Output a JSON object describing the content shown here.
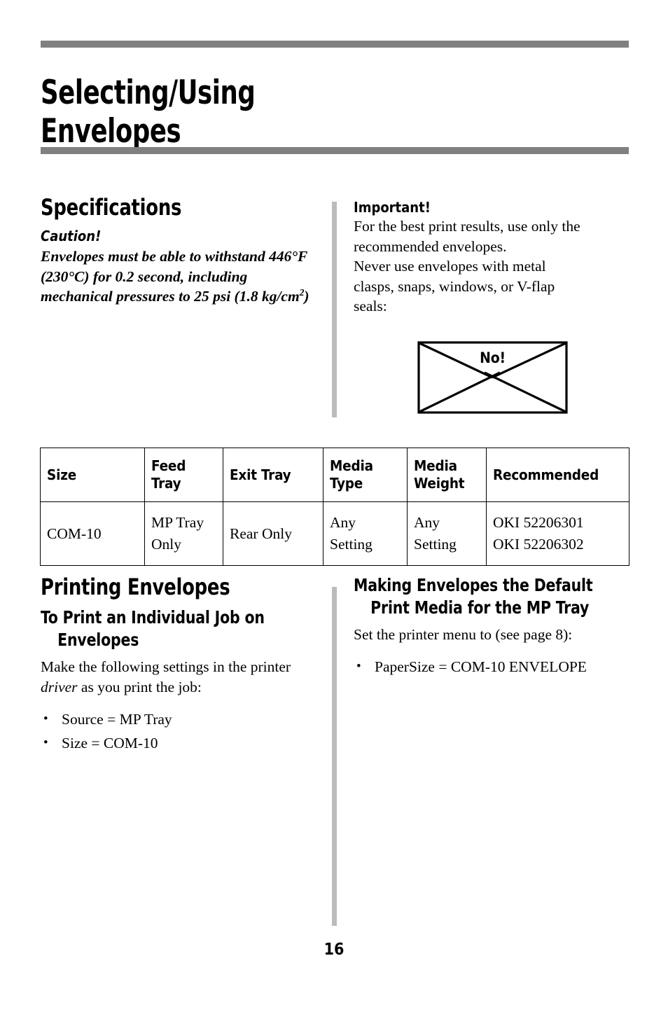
{
  "page": {
    "title": "Selecting/Using\nEnvelopes",
    "number": "16",
    "rule_color": "#808080",
    "divider_color": "#bcbcbc"
  },
  "specifications": {
    "heading": "Specifications",
    "caution_label": "Caution!",
    "caution_body_line1": "Envelopes must be able to withstand",
    "caution_body_line2": "446°F (230°C) for 0.2 second,",
    "caution_body_line3": "including mechanical pressures to 25",
    "caution_body_line4_pre": "psi (1.8 kg/cm",
    "caution_body_line4_sup": "2",
    "caution_body_line4_post": ")"
  },
  "important": {
    "label": "Important!",
    "line1": "For the best print results, use only the",
    "line2": "recommended envelopes.",
    "line3": "Never use envelopes with metal",
    "line4": "clasps, snaps, windows, or V-flap",
    "line5": "seals:"
  },
  "envelope_figure": {
    "label": "No!",
    "alt": "envelope-with-v-flap-not-allowed"
  },
  "table": {
    "headers": [
      "Size",
      "Feed Tray",
      "Exit Tray",
      "Media Type",
      "Media Weight",
      "Recommended"
    ],
    "rows": [
      {
        "size": "COM-10",
        "feed_tray_line1": "MP Tray",
        "feed_tray_line2": "Only",
        "exit_tray": "Rear Only",
        "media_type_line1": "Any",
        "media_type_line2": "Setting",
        "media_weight_line1": "Any",
        "media_weight_line2": "Setting",
        "recommended_line1": "OKI 52206301",
        "recommended_line2": "OKI 52206302"
      }
    ]
  },
  "printing_envelopes": {
    "heading": "Printing Envelopes",
    "subheading": "To Print an Individual Job on Envelopes",
    "intro_pre": "Make the following settings in the printer ",
    "intro_em": "driver",
    "intro_post": " as you print the job:",
    "bullets": [
      "Source = MP Tray",
      "Size = COM-10"
    ]
  },
  "default_media": {
    "heading": "Making Envelopes the Default Print Media for the MP Tray",
    "intro": "Set the printer menu to (see page 8):",
    "bullets": [
      "PaperSize = COM-10 ENVELOPE"
    ]
  }
}
